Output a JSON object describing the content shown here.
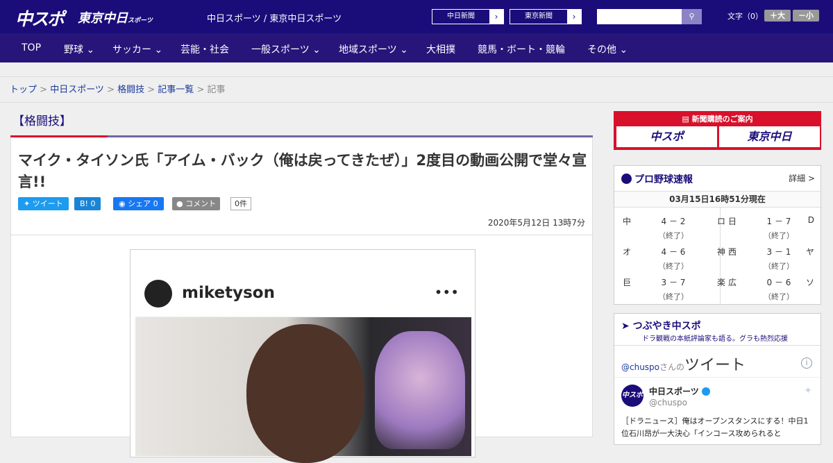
{
  "header": {
    "logo_main": "中スポ",
    "logo_sub": "東京中日",
    "logo_sub_small": "スポーツ",
    "site_name": "中日スポーツ / 東京中日スポーツ",
    "paper_buttons": [
      {
        "label": "中日新聞",
        "arrow": "›"
      },
      {
        "label": "東京新聞",
        "arrow": "›"
      }
    ],
    "search_placeholder": "",
    "search_icon": "search-icon",
    "font_label": "文字（0）",
    "font_larger": "＋大",
    "font_smaller": "－小"
  },
  "nav": {
    "items": [
      {
        "label": "TOP"
      },
      {
        "label": "野球 ⌄"
      },
      {
        "label": "サッカー ⌄"
      },
      {
        "label": "芸能・社会"
      },
      {
        "label": "一般スポーツ ⌄"
      },
      {
        "label": "地域スポーツ ⌄"
      },
      {
        "label": "大相撲"
      },
      {
        "label": "競馬・ボート・競輪"
      },
      {
        "label": "その他 ⌄"
      }
    ]
  },
  "breadcrumb": {
    "items": [
      "トップ",
      "中日スポーツ",
      "格闘技",
      "記事一覧"
    ],
    "separator": " > ",
    "current": "記事"
  },
  "article": {
    "section": "【格闘技】",
    "title": "マイク・タイソン氏「アイム・バック（俺は戻ってきたぜ）」2度目の動画公開で堂々宣言!!",
    "share": [
      {
        "label": "ツイート",
        "color": "#1d9bf0"
      },
      {
        "label": "B! 0",
        "color": "#1a84d6"
      },
      {
        "label": "シェア 0",
        "color": "#1877f2"
      }
    ],
    "comment_label": "コメント",
    "comment_count": "0件",
    "date": "2020年5月12日 13時7分",
    "embed": {
      "username": "miketyson",
      "more": "•••"
    }
  },
  "sidebar": {
    "subscribe": {
      "title": "新聞購読のご案内",
      "btn1": "中スポ",
      "btn2": "東京中日"
    },
    "scores": {
      "title": "プロ野球速報",
      "detail": "詳細 >",
      "time": "03月15日16時51分現在",
      "games": [
        {
          "t1": "中",
          "score": "4 － 2",
          "t2": "ロ",
          "status": "（終了）"
        },
        {
          "t1": "日",
          "score": "1 － 7",
          "t2": "D",
          "status": "（終了）"
        },
        {
          "t1": "オ",
          "score": "4 － 6",
          "t2": "神",
          "status": "（終了）"
        },
        {
          "t1": "西",
          "score": "3 － 1",
          "t2": "ヤ",
          "status": "（終了）"
        },
        {
          "t1": "巨",
          "score": "3 － 7",
          "t2": "楽",
          "status": "（終了）"
        },
        {
          "t1": "広",
          "score": "0 － 6",
          "t2": "ソ",
          "status": "（終了）"
        }
      ]
    },
    "tweets": {
      "title": "つぶやき中スポ",
      "subtitle": "ドラ観戦の本紙評論家も語る。グラも熱烈応援",
      "handle": "@chuspo",
      "handle_suffix": "さんの",
      "heading": "ツイート",
      "info": "i",
      "avatar_text": "中スポ",
      "name": "中日スポーツ",
      "screen": "@chuspo",
      "text": "［ドラニュース］俺はオープンスタンスにする！中日1位石川昂が一大決心「インコース攻められると"
    }
  }
}
